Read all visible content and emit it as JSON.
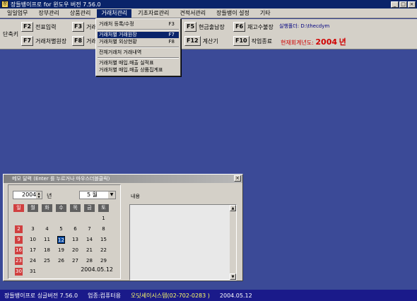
{
  "window": {
    "title": "장들뱅이프로 for 윈도우 버전 7.56.0",
    "icon_text": "장",
    "min": "_",
    "max": "□",
    "close": "×"
  },
  "menu": [
    "일일업무",
    "장부관리",
    "상품관리",
    "거래처관리",
    "기초자료관리",
    "견적서관리",
    "장들뱅이 설정",
    "기타"
  ],
  "toolbar": {
    "side_label": "단축키",
    "keys": [
      {
        "key": "F2",
        "label": "전표입력"
      },
      {
        "key": "F3",
        "label": "거래"
      },
      {
        "key": "F5",
        "label": "현금출납장"
      },
      {
        "key": "F6",
        "label": "재고수불장"
      },
      {
        "key": "F7",
        "label": "거래처별원장"
      },
      {
        "key": "F8",
        "label": "거래"
      },
      {
        "key": "F12",
        "label": "계산기"
      },
      {
        "key": "F10",
        "label": "작업종료"
      }
    ],
    "path": "실행폴더: D:\\thecdym",
    "year_prefix": "현재회계년도:",
    "year_value": "2004",
    "year_suffix": "년"
  },
  "dropdown": {
    "items": [
      {
        "label": "거래처 등록/수정",
        "shortcut": "F3"
      },
      {
        "label": "거래처별 거래원장",
        "shortcut": "F7"
      },
      {
        "label": "거래처별 외상현황",
        "shortcut": "F8"
      },
      {
        "label": "전체거래처 거래내역",
        "shortcut": ""
      },
      {
        "label": "거래처별 매입.매출 실적표",
        "shortcut": ""
      },
      {
        "label": "거래처별 매입.매출 상품집계표",
        "shortcut": ""
      }
    ]
  },
  "memo": {
    "title": "메모 달력 (Enter 를 누르거나 마우스더블클릭)",
    "close": "×",
    "year": "2004",
    "year_label": "년",
    "month": "5 월",
    "month_btn": "▼",
    "weekdays": [
      "일",
      "월",
      "화",
      "수",
      "목",
      "금",
      "토"
    ],
    "weeks": [
      [
        "",
        "",
        "",
        "",
        "",
        "",
        "1"
      ],
      [
        "2",
        "3",
        "4",
        "5",
        "6",
        "7",
        "8"
      ],
      [
        "9",
        "10",
        "11",
        "12",
        "13",
        "14",
        "15"
      ],
      [
        "16",
        "17",
        "18",
        "19",
        "20",
        "21",
        "22"
      ],
      [
        "23",
        "24",
        "25",
        "26",
        "27",
        "28",
        "29"
      ],
      [
        "30",
        "31",
        "",
        "",
        "",
        "",
        ""
      ]
    ],
    "today": "12",
    "date_display": "2004.05.12",
    "note_label": "내용",
    "spin_up": "▲",
    "spin_down": "▼"
  },
  "status": {
    "left": "장들뱅이프로 싱글버전 7.56.0",
    "middle": "업종:컴퓨터용",
    "company": "오딧세이시스템(02-702-0283 )",
    "date": "2004.05.12"
  }
}
